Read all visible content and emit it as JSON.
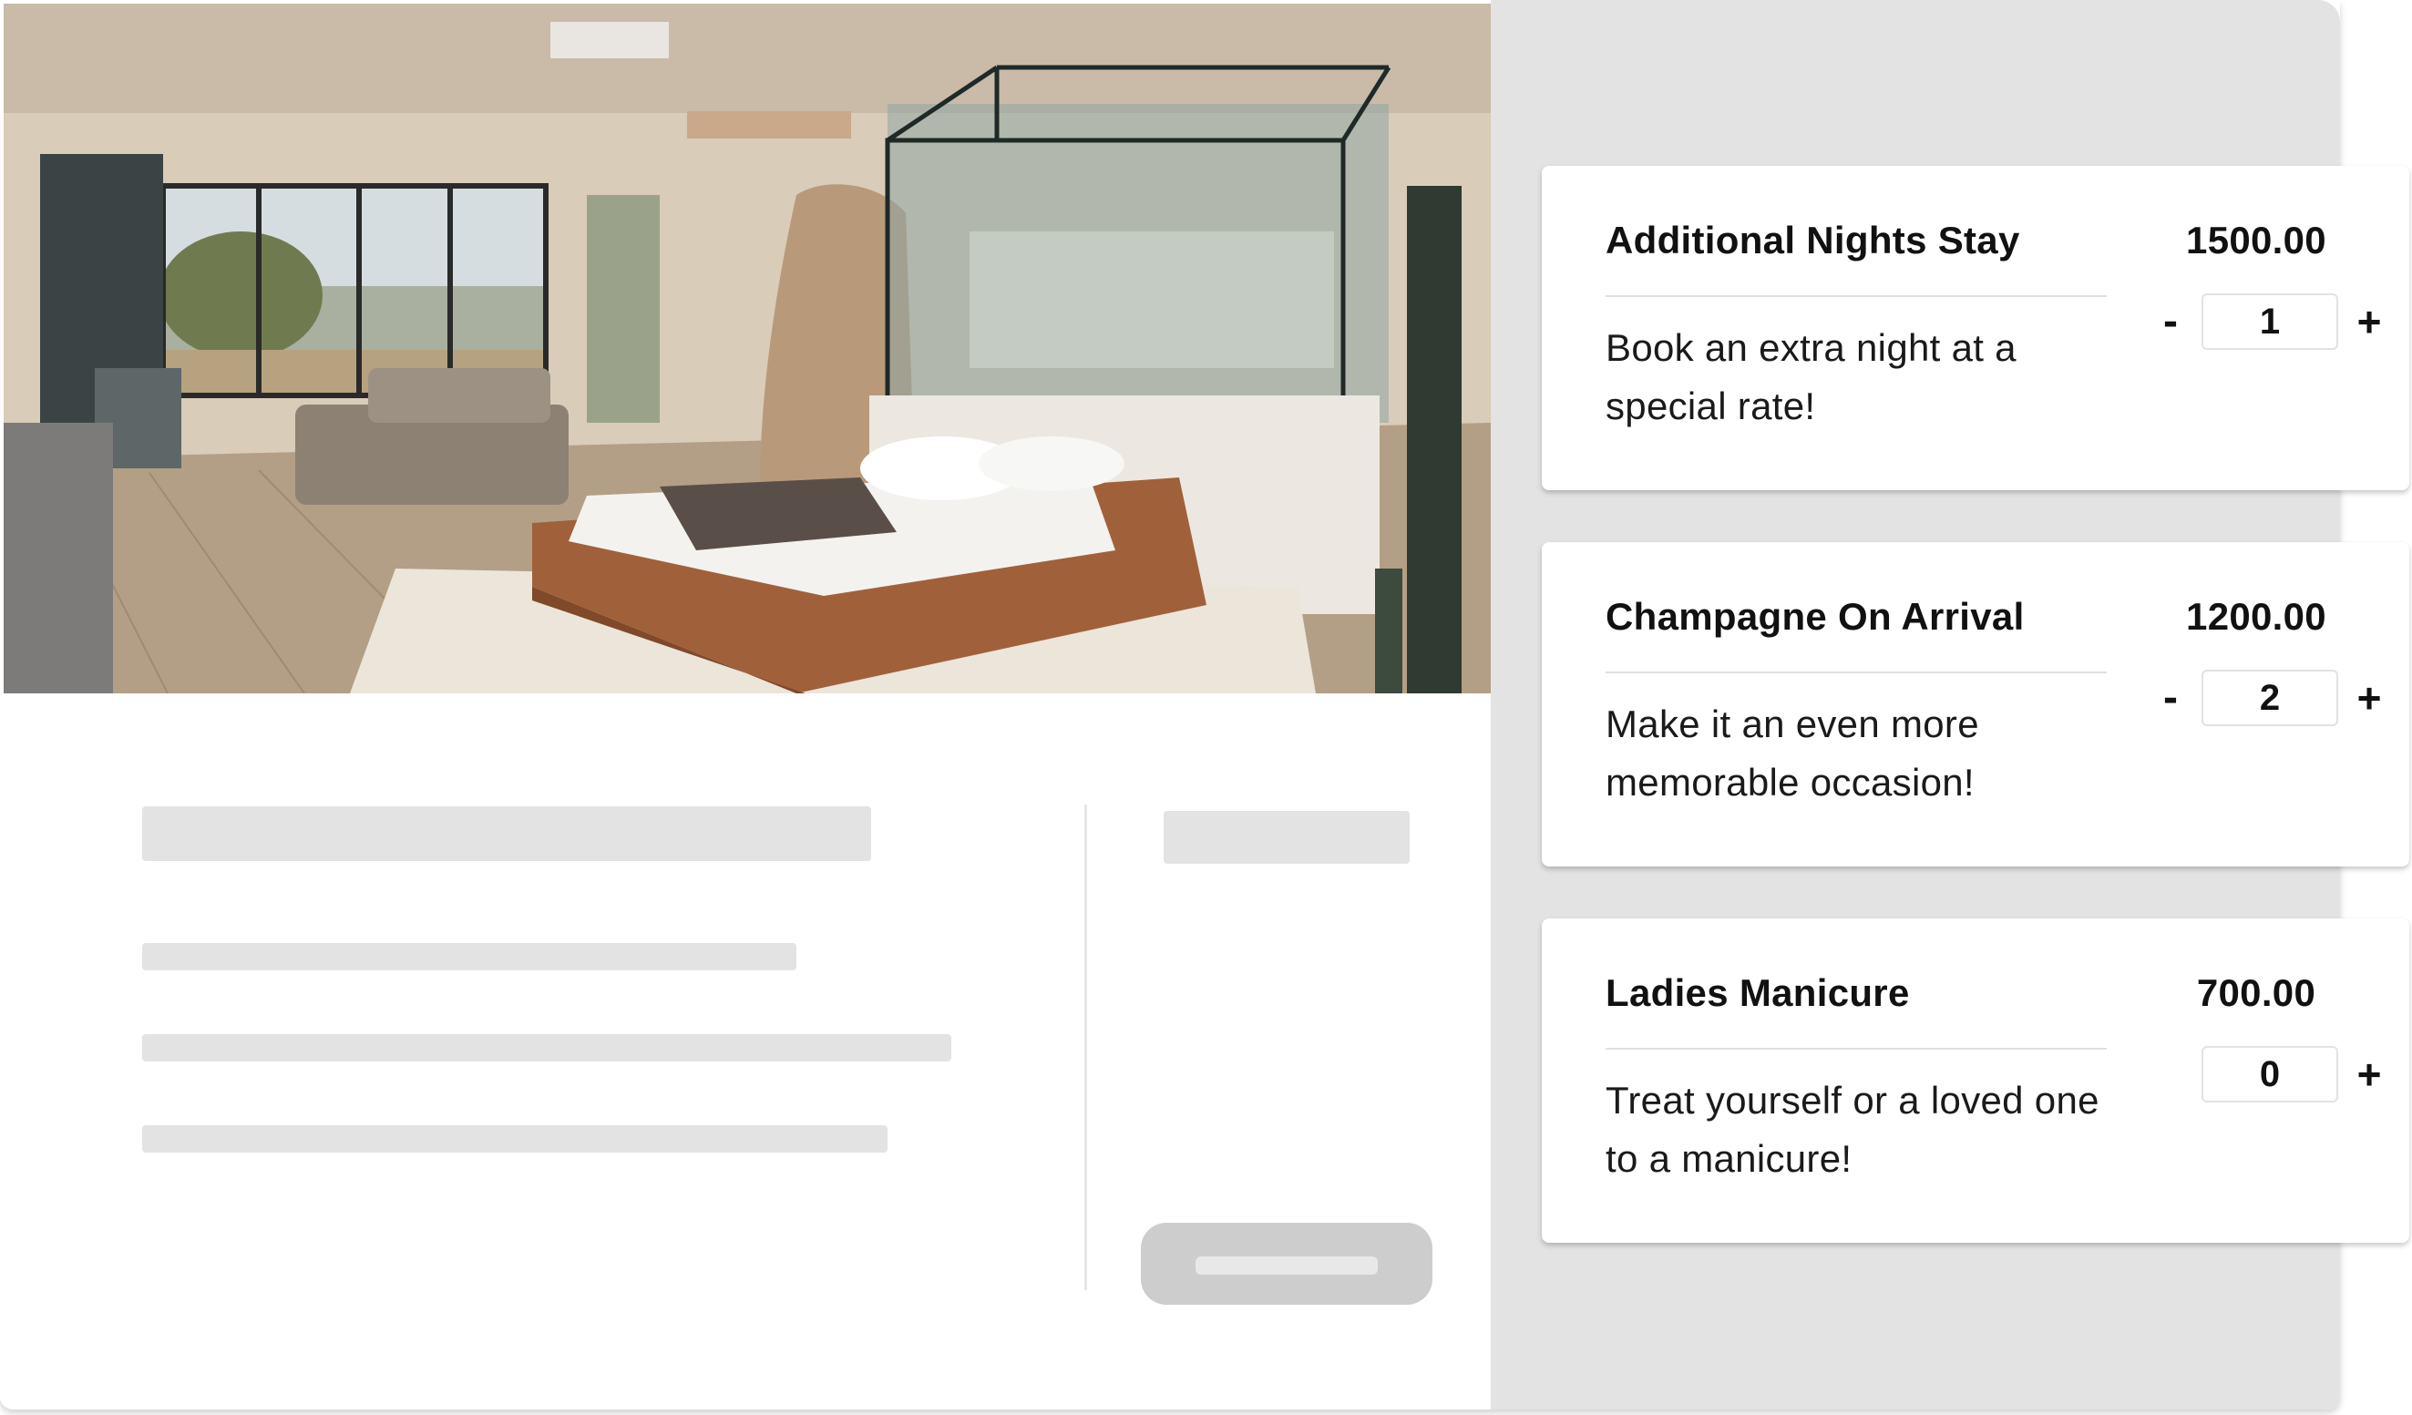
{
  "photo": {
    "alt": "hotel-room-photo"
  },
  "extras": [
    {
      "title": "Additional Nights Stay",
      "description": "Book an extra night at a special rate!",
      "price": "1500.00",
      "quantity": "1",
      "minus_label": "-",
      "plus_label": "+"
    },
    {
      "title": "Champagne On Arrival",
      "description": "Make it an even more memorable occasion!",
      "price": "1200.00",
      "quantity": "2",
      "minus_label": "-",
      "plus_label": "+"
    },
    {
      "title": "Ladies Manicure",
      "description": "Treat yourself or a loved one to a manicure!",
      "price": "700.00",
      "quantity": "0",
      "plus_label": "+"
    }
  ],
  "colors": {
    "panel_bg": "#e3e3e3",
    "skeleton": "#e3e3e3",
    "button_placeholder": "#cdcdcd",
    "text": "#111111"
  }
}
